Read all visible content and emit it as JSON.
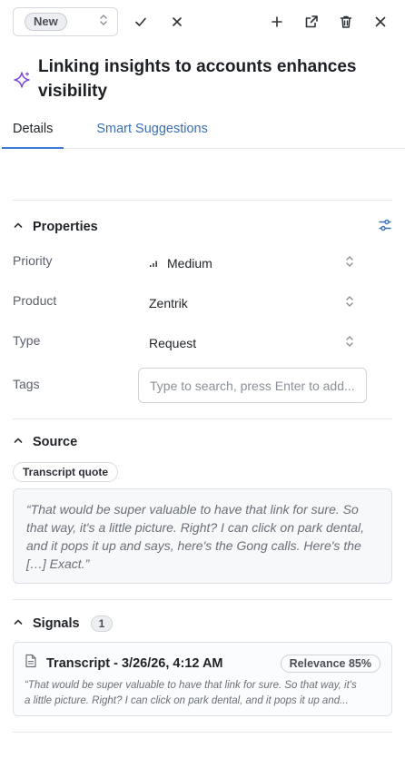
{
  "toolbar": {
    "status": "New",
    "icons": [
      "check-icon",
      "close-icon",
      "plus-icon",
      "external-link-icon",
      "trash-icon",
      "close-icon"
    ]
  },
  "title": "Linking insights to accounts enhances visibility",
  "tabs": [
    {
      "label": "Details",
      "active": true
    },
    {
      "label": "Smart Suggestions",
      "active": false
    }
  ],
  "properties": {
    "heading": "Properties",
    "priority": {
      "label": "Priority",
      "value": "Medium"
    },
    "product": {
      "label": "Product",
      "value": "Zentrik"
    },
    "type": {
      "label": "Type",
      "value": "Request"
    },
    "tags": {
      "label": "Tags",
      "placeholder": "Type to search, press Enter to add..."
    }
  },
  "source": {
    "heading": "Source",
    "chip": "Transcript quote",
    "quote": "“That would be super valuable to have that link for sure. So that way, it's a little picture. Right? I can click on park dental, and it pops it up and says, here's the Gong calls. Here's the […] Exact.”"
  },
  "signals": {
    "heading": "Signals",
    "count": "1",
    "items": [
      {
        "title": "Transcript - 3/26/26, 4:12 AM",
        "relevance": "Relevance 85%",
        "line1": "“That would be super valuable to have that link for sure. So that way, it's",
        "line2": "a little picture. Right? I can click on park dental, and it pops it up and..."
      }
    ]
  },
  "colors": {
    "accent": "#3a7bd5",
    "tab_inactive": "#3a6fb5",
    "sparkle": "#7c4ddb"
  }
}
